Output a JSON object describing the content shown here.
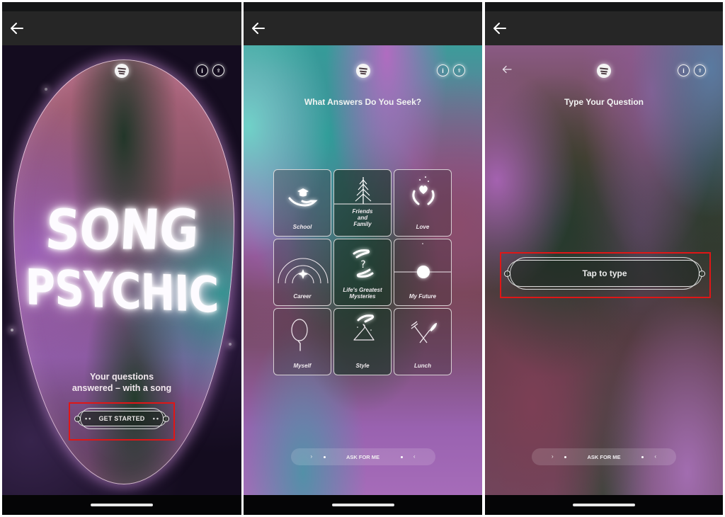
{
  "panels": {
    "welcome": {
      "title_line1": "SONG",
      "title_line2": "PSYCHIC",
      "tagline_line1": "Your questions",
      "tagline_line2": "answered – with a song",
      "cta_label": "GET STARTED",
      "cta_dots_left": "••",
      "cta_dots_right": "••"
    },
    "categories": {
      "heading": "What Answers Do You Seek?",
      "tiles": [
        {
          "label": "School",
          "icon": "graduation-cap-hand-icon"
        },
        {
          "label": "Friends and Family",
          "icon": "pine-tree-icon"
        },
        {
          "label": "Love",
          "icon": "heart-hands-icon"
        },
        {
          "label": "Career",
          "icon": "star-arcs-icon"
        },
        {
          "label": "Life's Greatest Mysteries",
          "icon": "hands-question-icon"
        },
        {
          "label": "My Future",
          "icon": "sun-horizon-icon"
        },
        {
          "label": "Myself",
          "icon": "hand-mirror-icon"
        },
        {
          "label": "Style",
          "icon": "hand-hanger-icon"
        },
        {
          "label": "Lunch",
          "icon": "fork-knife-icon"
        }
      ],
      "ask_label": "ASK FOR ME",
      "ask_left_glyph": "›",
      "ask_right_glyph": "‹"
    },
    "question": {
      "heading": "Type Your Question",
      "input_placeholder": "Tap to type",
      "ask_label": "ASK FOR ME",
      "ask_left_glyph": "›",
      "ask_right_glyph": "‹"
    }
  },
  "common": {
    "info_glyph": "i",
    "share_glyph": "⇪"
  },
  "colors": {
    "highlight": "#e01616",
    "app_bar": "#262626",
    "status_bar": "#151617"
  }
}
